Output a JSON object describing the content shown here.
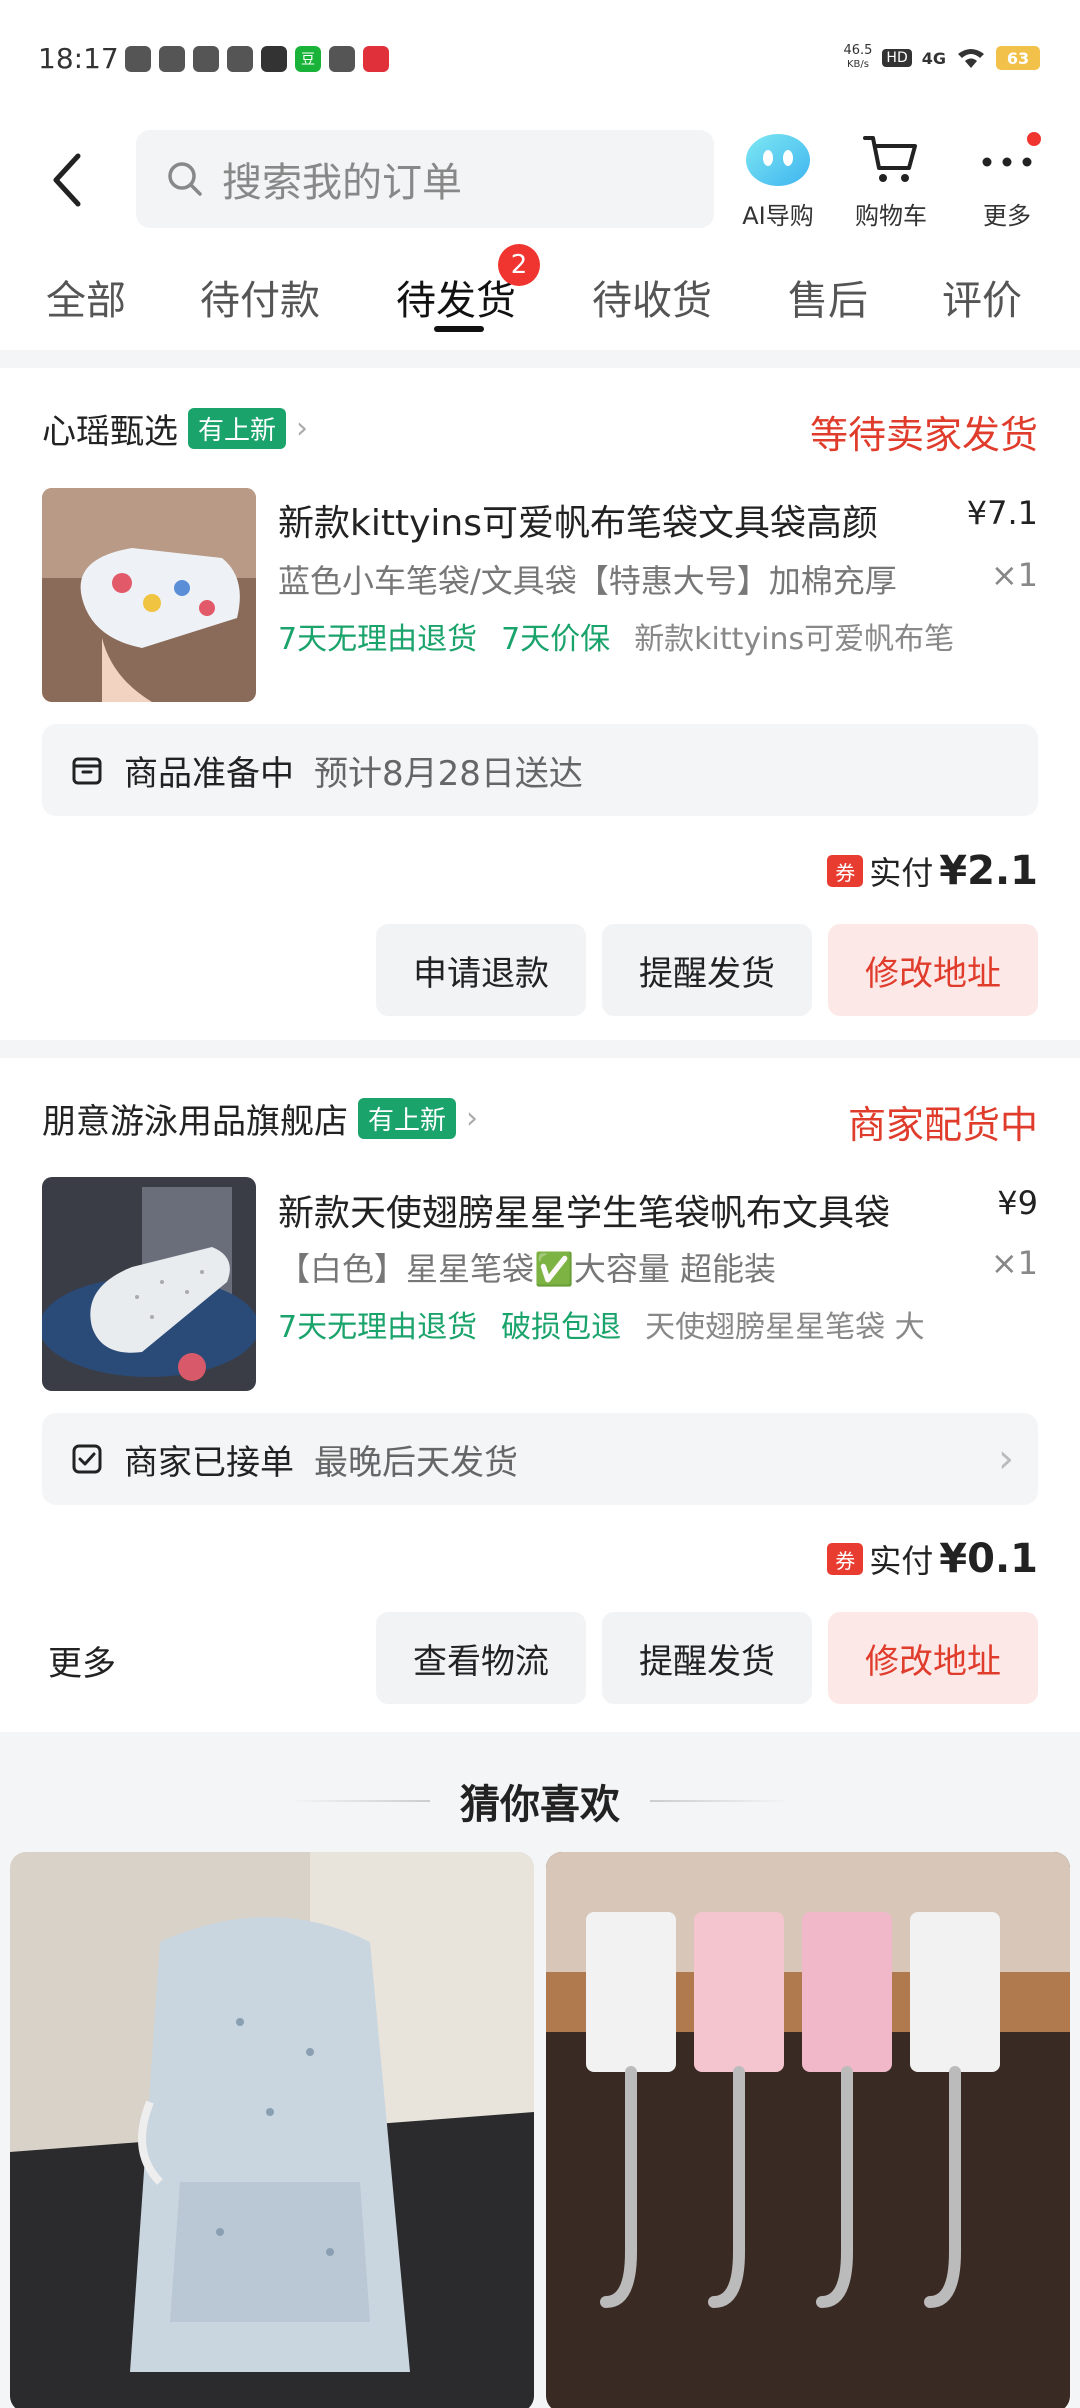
{
  "status_bar": {
    "time": "18:17",
    "net_speed_top": "46.5",
    "net_speed_unit": "KB/s",
    "hd": "HD",
    "network": "4G",
    "battery": "63"
  },
  "header": {
    "search_placeholder": "搜索我的订单",
    "ai_label": "AI导购",
    "cart_label": "购物车",
    "more_label": "更多"
  },
  "tabs": [
    {
      "label": "全部"
    },
    {
      "label": "待付款"
    },
    {
      "label": "待发货",
      "badge": "2"
    },
    {
      "label": "待收货"
    },
    {
      "label": "售后"
    },
    {
      "label": "评价"
    }
  ],
  "orders": [
    {
      "shop": "心瑶甄选",
      "new_tag": "有上新",
      "status": "等待卖家发货",
      "title": "新款kittyins可爱帆布笔袋文具袋高颜",
      "spec": "蓝色小车笔袋/文具袋【特惠大号】加棉充厚",
      "tag1": "7天无理由退货",
      "tag2": "7天价保",
      "tag3": "新款kittyins可爱帆布笔",
      "price": "¥7.1",
      "qty": "×1",
      "info_main": "商品准备中",
      "info_sub": "预计8月28日送达",
      "coupon": "券",
      "paid_label": "实付",
      "paid_amount": "¥2.1",
      "btn1": "申请退款",
      "btn2": "提醒发货",
      "btn3": "修改地址"
    },
    {
      "shop": "朋意游泳用品旗舰店",
      "new_tag": "有上新",
      "status": "商家配货中",
      "title": "新款天使翅膀星星学生笔袋帆布文具袋",
      "spec": "【白色】星星笔袋✅大容量 超能装",
      "tag1": "7天无理由退货",
      "tag2": "破损包退",
      "tag3": "天使翅膀星星笔袋 大",
      "price": "¥9",
      "qty": "×1",
      "info_main": "商家已接单",
      "info_sub": "最晚后天发货",
      "coupon": "券",
      "paid_label": "实付",
      "paid_amount": "¥0.1",
      "more": "更多",
      "btn1": "查看物流",
      "btn2": "提醒发货",
      "btn3": "修改地址"
    }
  ],
  "recommend": {
    "title": "猜你喜欢"
  },
  "colors": {
    "accent_red": "#e03c2c",
    "green": "#1aa36b",
    "bg_grey": "#f4f5f7"
  }
}
